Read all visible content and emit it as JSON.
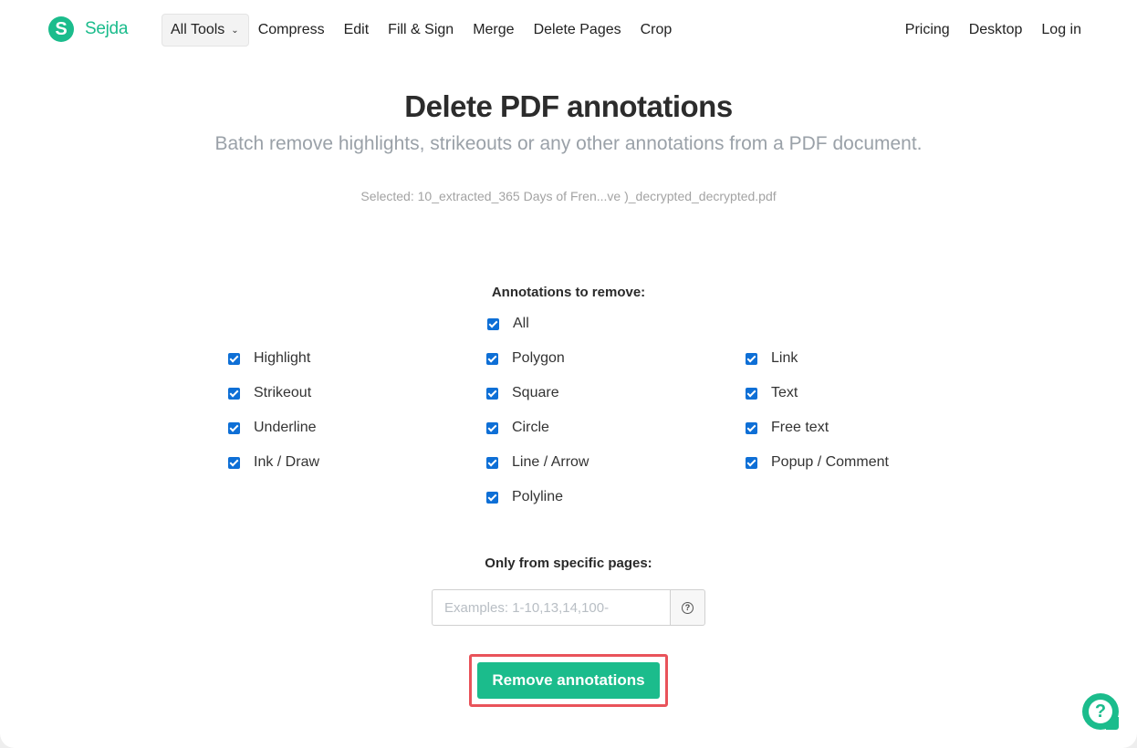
{
  "brand": {
    "logo_letter": "S",
    "name": "Sejda"
  },
  "nav": {
    "all_tools_label": "All Tools",
    "links": [
      "Compress",
      "Edit",
      "Fill & Sign",
      "Merge",
      "Delete Pages",
      "Crop"
    ],
    "right_links": [
      "Pricing",
      "Desktop",
      "Log in"
    ]
  },
  "header": {
    "title": "Delete PDF annotations",
    "subtitle": "Batch remove highlights, strikeouts or any other annotations from a PDF document.",
    "selected_file": "Selected: 10_extracted_365 Days of Fren...ve )_decrypted_decrypted.pdf"
  },
  "annotations": {
    "label": "Annotations to remove:",
    "all_label": "All",
    "col1": [
      "Highlight",
      "Strikeout",
      "Underline",
      "Ink / Draw"
    ],
    "col2": [
      "Polygon",
      "Square",
      "Circle",
      "Line / Arrow",
      "Polyline"
    ],
    "col3": [
      "Link",
      "Text",
      "Free text",
      "Popup / Comment"
    ]
  },
  "pages": {
    "label": "Only from specific pages:",
    "placeholder": "Examples: 1-10,13,14,100-",
    "value": "",
    "help_glyph": "?"
  },
  "submit": {
    "label": "Remove annotations"
  },
  "help_bubble": {
    "glyph": "?"
  },
  "colors": {
    "brand_green": "#1bbc8c",
    "checkbox_blue": "#0e6fd6",
    "highlight_red": "#e9535a"
  }
}
